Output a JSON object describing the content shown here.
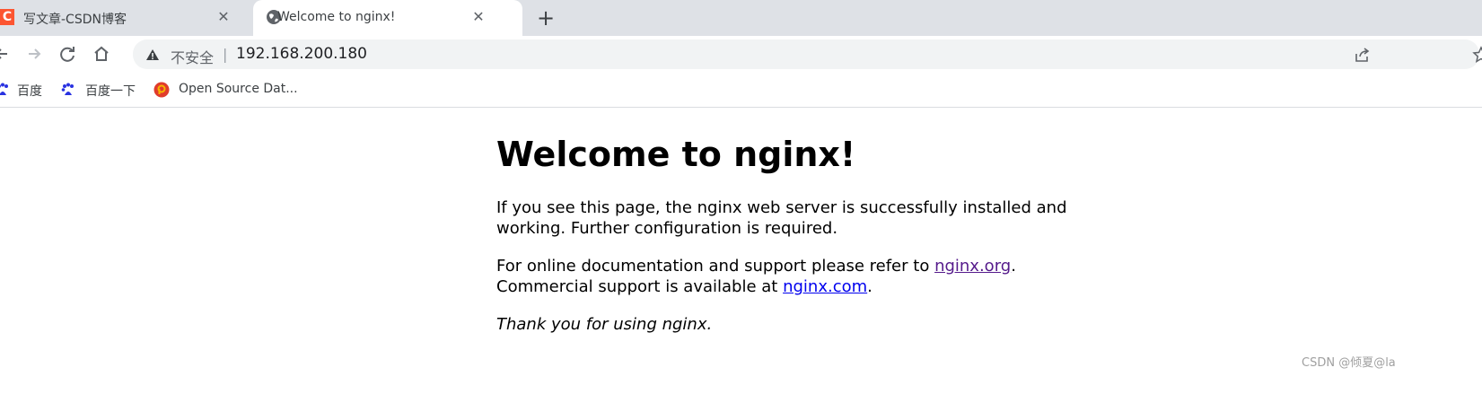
{
  "tabs": [
    {
      "title": "写文章-CSDN博客",
      "favicon_letter": "C",
      "close": "✕",
      "active": false
    },
    {
      "title": "Welcome to nginx!",
      "close": "✕",
      "active": true
    }
  ],
  "new_tab_label": "+",
  "toolbar": {
    "security_label": "不安全",
    "divider": "|",
    "url": "192.168.200.180"
  },
  "bookmarks": [
    {
      "label": "百度",
      "icon": "baidu-paw-icon"
    },
    {
      "label": "百度一下",
      "icon": "baidu-paw-icon"
    },
    {
      "label": "Open Source Dat...",
      "icon": "red-circle-p-icon"
    }
  ],
  "page": {
    "heading": "Welcome to nginx!",
    "para1": "If you see this page, the nginx web server is successfully installed and working. Further configuration is required.",
    "para2_text1": "For online documentation and support please refer to ",
    "link_org": "nginx.org",
    "para2_text2": ".",
    "para2_text3": "Commercial support is available at ",
    "link_com": "nginx.com",
    "para2_text4": ".",
    "para3": "Thank you for using nginx."
  },
  "watermark": "CSDN @倾夏@la",
  "colors": {
    "tabbar_bg": "#dee1e6",
    "visited_link": "#551a8b",
    "link": "#0000ee",
    "csdn_red": "#fc5531"
  }
}
